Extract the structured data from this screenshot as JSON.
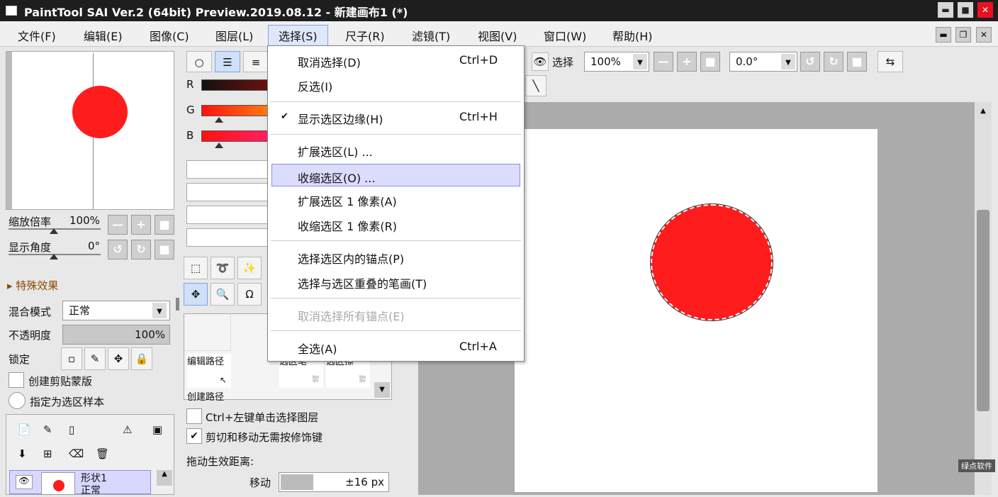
{
  "window": {
    "title": "PaintTool SAI Ver.2 (64bit) Preview.2019.08.12 - 新建画布1 (*)",
    "min": "▬",
    "max": "■",
    "close": "✕"
  },
  "menubar": {
    "items": [
      "文件(F)",
      "编辑(E)",
      "图像(C)",
      "图层(L)",
      "选择(S)",
      "尺子(R)",
      "滤镜(T)",
      "视图(V)",
      "窗口(W)",
      "帮助(H)"
    ]
  },
  "nav": {
    "zoom_label": "缩放倍率",
    "zoom_value": "100%",
    "angle_label": "显示角度",
    "angle_value": "0°"
  },
  "effects": {
    "label": "特殊效果"
  },
  "layer_props": {
    "blend_label": "混合模式",
    "blend_value": "正常",
    "opacity_label": "不透明度",
    "opacity_value": "100%",
    "lock_label": "锁定",
    "clip_label": "创建剪贴蒙版",
    "sample_label": "指定为选区样本"
  },
  "layer": {
    "name": "形状1",
    "mode": "正常"
  },
  "color": {
    "r": "R",
    "g": "G",
    "b": "B"
  },
  "pathpanel": {
    "edit": "编辑路径",
    "create": "创建路径",
    "sel_pen": "选区笔",
    "sel_eraser": "选区擦"
  },
  "options": {
    "ctrl_click": "Ctrl+左键单击选择图层",
    "cut_move": "剪切和移动无需按修饰键",
    "drag_label": "拖动生效距离:",
    "move_label": "移动",
    "move_value": "±16 px"
  },
  "toolbar": {
    "select_label": "选择",
    "zoom": "100%",
    "angle": "0.0°"
  },
  "menu": {
    "items": [
      {
        "label": "取消选择(D)",
        "shortcut": "Ctrl+D"
      },
      {
        "label": "反选(I)",
        "shortcut": ""
      },
      {
        "label": "显示选区边缘(H)",
        "shortcut": "Ctrl+H"
      },
      {
        "label": "扩展选区(L) ...",
        "shortcut": ""
      },
      {
        "label": "收缩选区(O) ...",
        "shortcut": ""
      },
      {
        "label": "扩展选区 1 像素(A)",
        "shortcut": ""
      },
      {
        "label": "收缩选区 1 像素(R)",
        "shortcut": ""
      },
      {
        "label": "选择选区内的锚点(P)",
        "shortcut": ""
      },
      {
        "label": "选择与选区重叠的笔画(T)",
        "shortcut": ""
      },
      {
        "label": "取消选择所有锚点(E)",
        "shortcut": ""
      },
      {
        "label": "全选(A)",
        "shortcut": "Ctrl+A"
      }
    ]
  },
  "watermark": "绿点软件"
}
